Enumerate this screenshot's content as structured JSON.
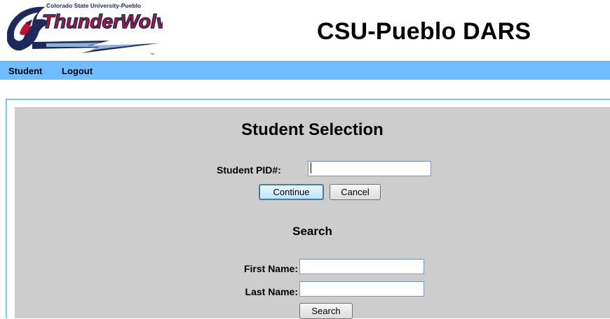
{
  "header": {
    "logo": {
      "text_top": "Colorado State University-Pueblo",
      "text_main": "ThunderWolves"
    },
    "title": "CSU-Pueblo DARS"
  },
  "menu": {
    "items": [
      "Student",
      "Logout"
    ]
  },
  "student_selection": {
    "title": "Student Selection",
    "pid_label": "Student PID#:",
    "pid_value": "",
    "continue_label": "Continue",
    "cancel_label": "Cancel"
  },
  "search": {
    "title": "Search",
    "first_name_label": "First Name:",
    "first_name_value": "",
    "last_name_label": "Last Name:",
    "last_name_value": "",
    "search_label": "Search"
  },
  "colors": {
    "menubar": "#6fbcff",
    "panel": "#cdcdcd",
    "logo_red": "#c8102e",
    "logo_navy": "#1c2a5c"
  }
}
